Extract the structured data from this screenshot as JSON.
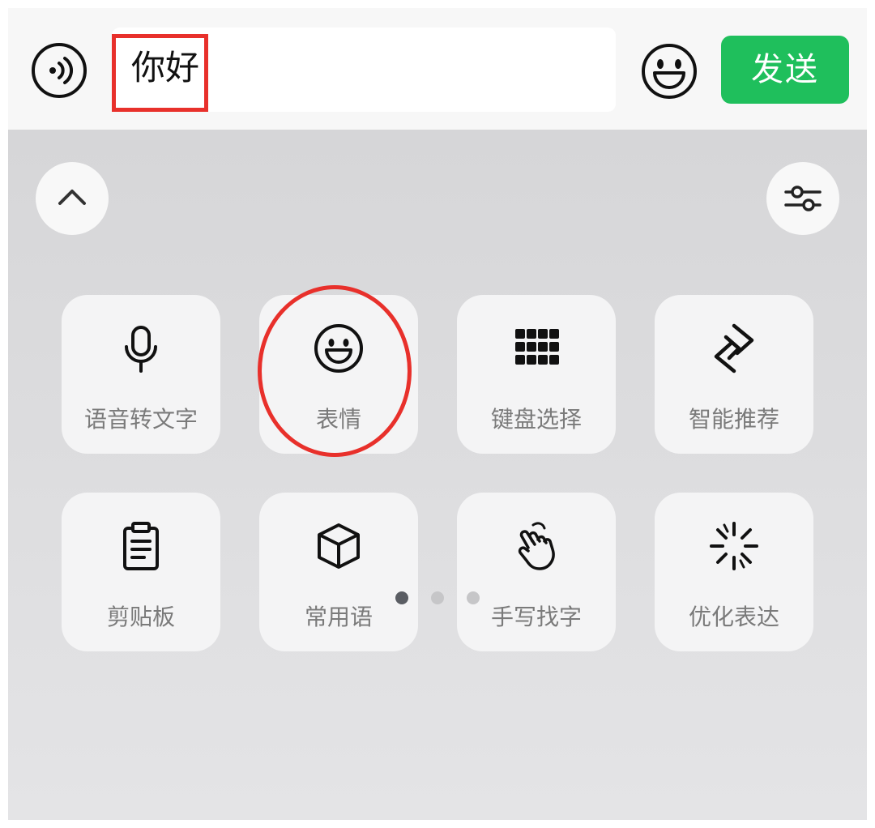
{
  "input_bar": {
    "text": "你好",
    "send_label": "发送",
    "voice_icon": "voice-wave-icon",
    "emoji_icon": "smile-face-icon"
  },
  "panel": {
    "collapse_icon": "chevron-up-icon",
    "settings_icon": "sliders-icon",
    "tiles": [
      {
        "label": "语音转文字",
        "icon": "microphone-icon"
      },
      {
        "label": "表情",
        "icon": "emoji-icon"
      },
      {
        "label": "键盘选择",
        "icon": "keypad-grid-icon"
      },
      {
        "label": "智能推荐",
        "icon": "smart-diamond-icon"
      },
      {
        "label": "剪贴板",
        "icon": "clipboard-icon"
      },
      {
        "label": "常用语",
        "icon": "cube-icon"
      },
      {
        "label": "手写找字",
        "icon": "handwriting-hand-icon"
      },
      {
        "label": "优化表达",
        "icon": "sparkle-icon"
      }
    ],
    "pagination": {
      "pages": 3,
      "active": 1
    }
  },
  "colors": {
    "send_green": "#1fbf5c",
    "annotation_red": "#e8302b"
  }
}
